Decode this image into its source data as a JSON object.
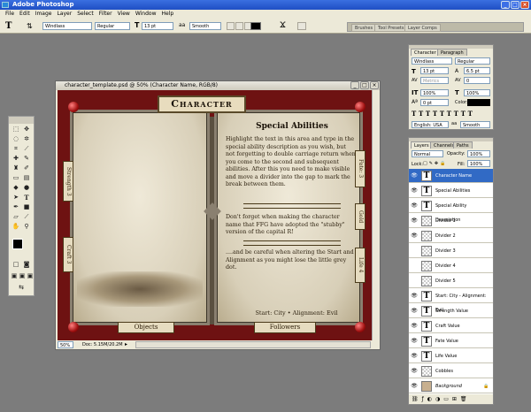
{
  "app": {
    "title": "Adobe Photoshop"
  },
  "menu": [
    "File",
    "Edit",
    "Image",
    "Layer",
    "Select",
    "Filter",
    "View",
    "Window",
    "Help"
  ],
  "options": {
    "font_family": "Windlass",
    "font_style": "Regular",
    "font_size": "13 pt",
    "anti_alias": "Smooth"
  },
  "wells": [
    "Brushes",
    "Tool Presets",
    "Layer Comps"
  ],
  "document": {
    "title": "character_template.psd @ 50% (Character Name, RGB/8)",
    "zoom": "50%",
    "doc_size": "Doc: 5.15M/20.2M",
    "heading": "Character",
    "section_title": "Special Abilities",
    "para1": "Highlight the text in this area and type in the special ability description as you wish, but not forgetting to double carriage return when you come to the second and subsequent abilities. After this you need to make visible and move a divider into the gap to mark the break between them.",
    "para2": "Don't forget when making the character name that FFG have adopted the \"stubby\" version of the capital R!",
    "para3": "....and be careful when altering the Start and Alignment as you might lose the little grey dot.",
    "start_line": "Start: City • Alignment: Evil",
    "left_tabs": [
      "Strength 3",
      "Craft 3"
    ],
    "right_tabs": [
      "Fate: 3",
      "Gold",
      "Life 4"
    ],
    "bottom_left": "Objects",
    "bottom_right": "Followers"
  },
  "char_panel": {
    "tabs": [
      "Character",
      "Paragraph"
    ],
    "font": "Windlass",
    "style": "Regular",
    "size": "13 pt",
    "leading": "6.5 pt",
    "tracking_label": "Metrics",
    "tracking": "0",
    "vscale": "100%",
    "hscale": "100%",
    "baseline": "0 pt",
    "color_label": "Color:",
    "language": "English: USA",
    "aa": "aa",
    "aa_mode": "Smooth"
  },
  "layers_panel": {
    "tabs": [
      "Layers",
      "Channels",
      "Paths"
    ],
    "blend": "Normal",
    "opacity_label": "Opacity:",
    "opacity": "100%",
    "lock_label": "Lock:",
    "fill_label": "Fill:",
    "fill": "100%",
    "layers": [
      {
        "name": "Character Name",
        "type": "T",
        "visible": true,
        "selected": true
      },
      {
        "name": "Special Abilities",
        "type": "T",
        "visible": true
      },
      {
        "name": "Special Ability Description",
        "type": "T",
        "visible": true
      },
      {
        "name": "Divider 1",
        "type": "chk",
        "visible": true
      },
      {
        "name": "Divider 2",
        "type": "chk",
        "visible": true
      },
      {
        "name": "Divider 3",
        "type": "chk",
        "visible": false
      },
      {
        "name": "Divider 4",
        "type": "chk",
        "visible": false
      },
      {
        "name": "Divider 5",
        "type": "chk",
        "visible": false
      },
      {
        "name": "Start: City - Alignment: Evil",
        "type": "T",
        "visible": true
      },
      {
        "name": "Strength Value",
        "type": "T",
        "visible": true
      },
      {
        "name": "Craft Value",
        "type": "T",
        "visible": true
      },
      {
        "name": "Fate Value",
        "type": "T",
        "visible": true
      },
      {
        "name": "Life Value",
        "type": "T",
        "visible": true
      },
      {
        "name": "Cobbles",
        "type": "chk",
        "visible": true
      },
      {
        "name": "Background",
        "type": "bg",
        "visible": true
      }
    ]
  }
}
